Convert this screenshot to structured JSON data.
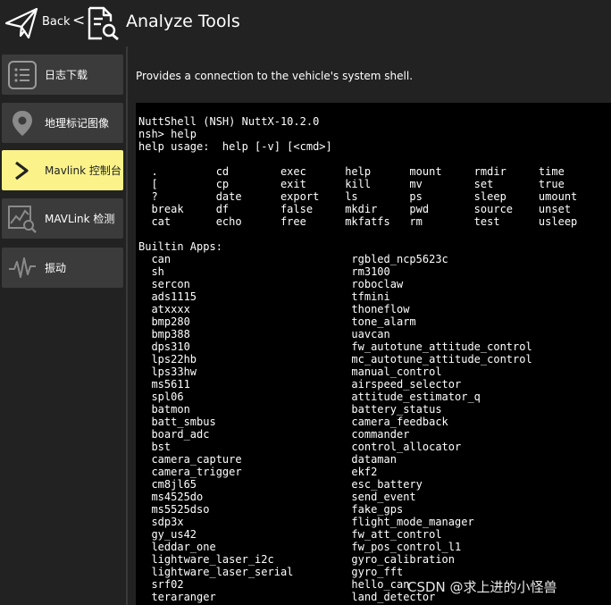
{
  "header": {
    "back_label": "Back",
    "chevron": "<",
    "title": "Analyze Tools",
    "logo_icon": "paper-plane-icon",
    "tools_icon": "document-search-icon"
  },
  "sidebar": {
    "items": [
      {
        "label": "日志下载",
        "icon": "list-icon",
        "active": false
      },
      {
        "label": "地理标记图像",
        "icon": "map-pin-icon",
        "active": false
      },
      {
        "label": "Mavlink 控制台",
        "icon": "chevron-right-icon",
        "active": true
      },
      {
        "label": "MAVLink 检测",
        "icon": "chart-search-icon",
        "active": false
      },
      {
        "label": "振动",
        "icon": "waveform-icon",
        "active": false
      }
    ],
    "active_color": "#fbf38a"
  },
  "main": {
    "description": "Provides a connection to the vehicle's system shell."
  },
  "console": {
    "text": "NuttShell (NSH) NuttX-10.2.0\nnsh> help\nhelp usage:  help [-v] [<cmd>]\n\n  .         cd        exec      help      mount     rmdir     time\n  [         cp        exit      kill      mv        set       true\n  ?         date      export    ls        ps        sleep     umount\n  break     df        false     mkdir     pwd       source    unset\n  cat       echo      free      mkfatfs   rm        test      usleep\n\nBuiltin Apps:\n  can                            rgbled_ncp5623c\n  sh                             rm3100\n  sercon                         roboclaw\n  ads1115                        tfmini\n  atxxxx                         thoneflow\n  bmp280                         tone_alarm\n  bmp388                         uavcan\n  dps310                         fw_autotune_attitude_control\n  lps22hb                        mc_autotune_attitude_control\n  lps33hw                        manual_control\n  ms5611                         airspeed_selector\n  spl06                          attitude_estimator_q\n  batmon                         battery_status\n  batt_smbus                     camera_feedback\n  board_adc                      commander\n  bst                            control_allocator\n  camera_capture                 dataman\n  camera_trigger                 ekf2\n  cm8jl65                        esc_battery\n  ms4525do                       send_event\n  ms5525dso                      fake_gps\n  sdp3x                          flight_mode_manager\n  gy_us42                        fw_att_control\n  leddar_one                     fw_pos_control_l1\n  lightware_laser_i2c            gyro_calibration\n  lightware_laser_serial         gyro_fft\n  srf02                          hello_can\n  teraranger                     land_detector"
  },
  "watermark": "CSDN @求上进的小怪兽"
}
